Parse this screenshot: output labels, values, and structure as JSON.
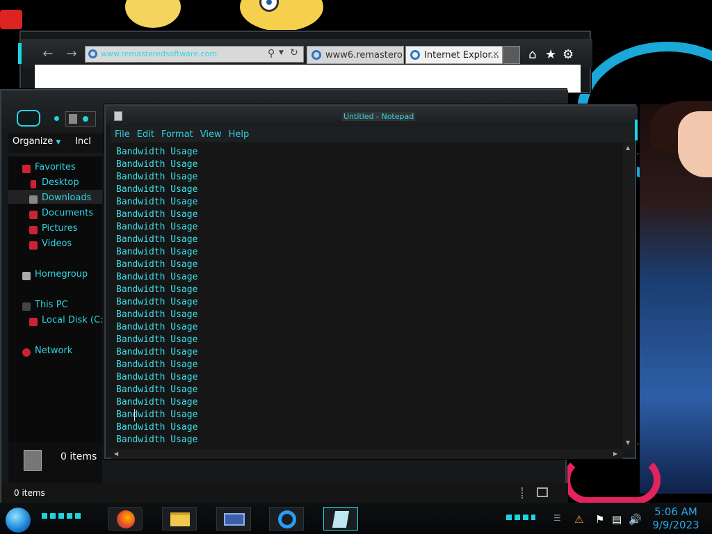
{
  "ie": {
    "address_url": "www.remasteredsoftware.com",
    "tabs": [
      {
        "label": "www6.remastero..."
      },
      {
        "label": "Internet Explor..."
      }
    ],
    "tab_close": "✕",
    "icons": [
      "back-arrow-icon",
      "forward-arrow-icon",
      "search-icon",
      "refresh-icon",
      "home-icon",
      "favorites-star-icon",
      "gear-icon"
    ]
  },
  "explorer": {
    "organize_label": "Organize",
    "include_label": "Incl",
    "nav": {
      "favorites": "Favorites",
      "desktop": "Desktop",
      "downloads": "Downloads",
      "documents": "Documents",
      "pictures": "Pictures",
      "videos": "Videos",
      "homegroup": "Homegroup",
      "this_pc": "This PC",
      "local_disk": "Local Disk (C:",
      "network": "Network"
    },
    "items_count_panel": "0 items",
    "status_bar_text": "0 items"
  },
  "notepad": {
    "title": "Untitled - Notepad",
    "menu": {
      "file": "File",
      "edit": "Edit",
      "format": "Format",
      "view": "View",
      "help": "Help"
    },
    "content": "Bandwidth Usage\nBandwidth Usage\nBandwidth Usage\nBandwidth Usage\nBandwidth Usage\nBandwidth Usage\nBandwidth Usage\nBandwidth Usage\nBandwidth Usage\nBandwidth Usage\nBandwidth Usage\nBandwidth Usage\nBandwidth Usage\nBandwidth Usage\nBandwidth Usage\nBandwidth Usage\nBandwidth Usage\nBandwidth Usage\nBandwidth Usage\nBandwidth Usage\nBandwidth Usage\nBandwidth Usage\nBandwidth Usage\nBandwidth Usage"
  },
  "taskbar": {
    "time": "5:06 AM",
    "date": "9/9/2023",
    "pinned": [
      "firefox-icon",
      "file-explorer-icon",
      "windows-explorer-icon",
      "internet-explorer-icon",
      "notepad-icon"
    ]
  },
  "colors": {
    "accent": "#1bd6e0",
    "text_cyan": "#3ce0ea",
    "window_bg": "#16191c"
  }
}
